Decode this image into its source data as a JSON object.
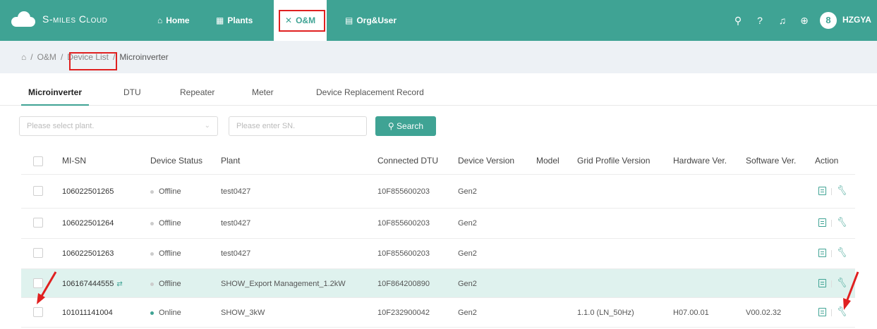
{
  "app": {
    "logo_text": "S-miles Cloud"
  },
  "nav": {
    "home": "Home",
    "plants": "Plants",
    "om": "O&M",
    "org_user": "Org&User",
    "user": "HZGYA",
    "avatar_initial": "8"
  },
  "breadcrumb": {
    "om": "O&M",
    "device_list": "Device List",
    "current": "Microinverter"
  },
  "tabs": [
    "Microinverter",
    "DTU",
    "Repeater",
    "Meter",
    "Device Replacement Record"
  ],
  "filters": {
    "plant_placeholder": "Please select plant.",
    "sn_placeholder": "Please enter SN.",
    "search_label": "Search"
  },
  "table": {
    "columns": [
      "MI-SN",
      "Device Status",
      "Plant",
      "Connected DTU",
      "Device Version",
      "Model",
      "Grid Profile Version",
      "Hardware Ver.",
      "Software Ver.",
      "Action"
    ],
    "rows": [
      {
        "sn": "106022501265",
        "status": "Offline",
        "plant": "test0427",
        "dtu": "10F855600203",
        "version": "Gen2",
        "model": "",
        "grid": "",
        "hw": "",
        "sw": ""
      },
      {
        "sn": "106022501264",
        "status": "Offline",
        "plant": "test0427",
        "dtu": "10F855600203",
        "version": "Gen2",
        "model": "",
        "grid": "",
        "hw": "",
        "sw": ""
      },
      {
        "sn": "106022501263",
        "status": "Offline",
        "plant": "test0427",
        "dtu": "10F855600203",
        "version": "Gen2",
        "model": "",
        "grid": "",
        "hw": "",
        "sw": ""
      },
      {
        "sn": "106167444555",
        "status": "Offline",
        "plant": "SHOW_Export Management_1.2kW",
        "dtu": "10F864200890",
        "version": "Gen2",
        "model": "",
        "grid": "",
        "hw": "",
        "sw": ""
      },
      {
        "sn": "101011141004",
        "status": "Online",
        "plant": "SHOW_3kW",
        "dtu": "10F232900042",
        "version": "Gen2",
        "model": "",
        "grid": "1.1.0 (LN_50Hz)",
        "hw": "H07.00.01",
        "sw": "V00.02.32"
      }
    ]
  },
  "colors": {
    "brand": "#3fa394",
    "highlight_row": "#dff2ee",
    "annotation_red": "#e02020"
  }
}
